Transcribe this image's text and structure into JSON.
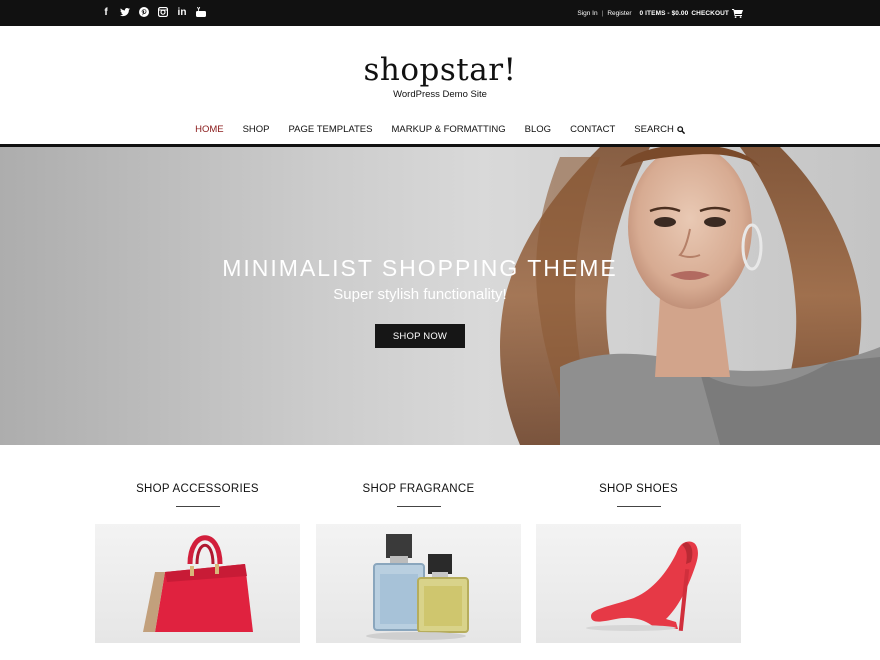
{
  "topbar": {
    "social_icons": [
      "facebook-icon",
      "twitter-icon",
      "pinterest-icon",
      "instagram-icon",
      "linkedin-icon",
      "youtube-icon"
    ],
    "sign_in": "Sign In",
    "separator": "|",
    "register": "Register",
    "cart_summary": "0 ITEMS - $0.00",
    "checkout": "CHECKOUT",
    "cart_icon": "cart-icon"
  },
  "brand": {
    "title": "shopstar!",
    "tagline": "WordPress Demo Site"
  },
  "nav": {
    "items": [
      "HOME",
      "SHOP",
      "PAGE TEMPLATES",
      "MARKUP & FORMATTING",
      "BLOG",
      "CONTACT",
      "SEARCH"
    ],
    "active": "HOME",
    "search_icon": "search-icon"
  },
  "hero": {
    "title": "MINIMALIST SHOPPING THEME",
    "subtitle": "Super stylish functionality!",
    "button": "SHOP NOW"
  },
  "categories": [
    {
      "title": "SHOP ACCESSORIES",
      "image": "red-handbag"
    },
    {
      "title": "SHOP FRAGRANCE",
      "image": "perfume-bottles"
    },
    {
      "title": "SHOP SHOES",
      "image": "red-high-heel"
    }
  ],
  "colors": {
    "topbar": "#111111",
    "active_nav": "#8a1a1a",
    "button": "#161616"
  }
}
